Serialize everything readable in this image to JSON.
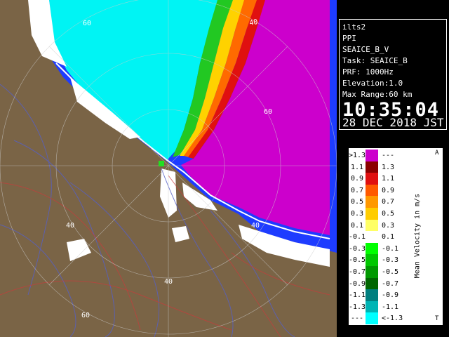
{
  "map": {
    "range_labels": [
      "60",
      "40",
      "60",
      "40",
      "40",
      "40",
      "60",
      "40"
    ]
  },
  "info": {
    "site": "ilts2",
    "product": "PPI",
    "scan": "SEAICE_B_V",
    "task": "Task: SEAICE_B",
    "prf": "PRF: 1000Hz",
    "elevation": "Elevation:1.0",
    "max_range": "Max Range:60 km",
    "time": "10:35:04",
    "date": "28 DEC 2018 JST"
  },
  "legend": {
    "title": "Mean Velocity in m/s",
    "corner_top": "A",
    "corner_bottom": "T",
    "rows": [
      {
        "left": ">1.3",
        "right": "---",
        "color": "#cc00cc"
      },
      {
        "left": "1.1",
        "right": "1.3",
        "color": "#8b0000"
      },
      {
        "left": "0.9",
        "right": "1.1",
        "color": "#e01010"
      },
      {
        "left": "0.7",
        "right": "0.9",
        "color": "#ff5a00"
      },
      {
        "left": "0.5",
        "right": "0.7",
        "color": "#ff9800"
      },
      {
        "left": "0.3",
        "right": "0.5",
        "color": "#ffcc00"
      },
      {
        "left": "0.1",
        "right": "0.3",
        "color": "#ffff66"
      },
      {
        "left": "-0.1",
        "right": "0.1",
        "color": "#ffffff"
      },
      {
        "left": "-0.3",
        "right": "-0.1",
        "color": "#00ff00"
      },
      {
        "left": "-0.5",
        "right": "-0.3",
        "color": "#00c800"
      },
      {
        "left": "-0.7",
        "right": "-0.5",
        "color": "#009900"
      },
      {
        "left": "-0.9",
        "right": "-0.7",
        "color": "#006600"
      },
      {
        "left": "-1.1",
        "right": "-0.9",
        "color": "#007f7f"
      },
      {
        "left": "-1.3",
        "right": "-1.1",
        "color": "#00b4b4"
      },
      {
        "left": "---",
        "right": "<-1.3",
        "color": "#00ffff"
      }
    ]
  }
}
